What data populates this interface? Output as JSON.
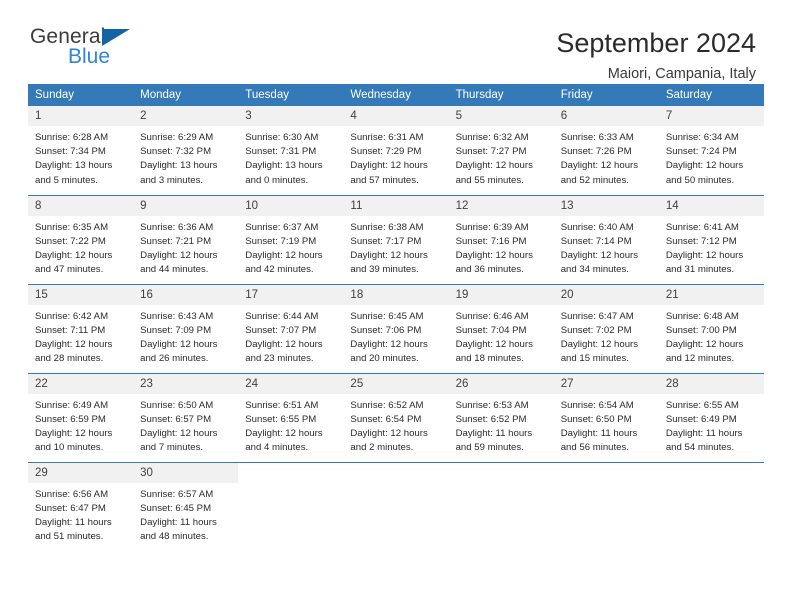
{
  "brand": {
    "name_part1": "General",
    "name_part2": "Blue",
    "triangle_color": "#1464a5",
    "blue_color": "#2f86d4"
  },
  "header": {
    "title": "September 2024",
    "subtitle": "Maiori, Campania, Italy"
  },
  "theme": {
    "header_blue": "#3479b8",
    "daynum_band": "#f1f1f1",
    "text": "#2b2b2b"
  },
  "weekday_headers": [
    "Sunday",
    "Monday",
    "Tuesday",
    "Wednesday",
    "Thursday",
    "Friday",
    "Saturday"
  ],
  "weeks": [
    [
      {
        "day": "1",
        "sunrise": "Sunrise: 6:28 AM",
        "sunset": "Sunset: 7:34 PM",
        "daylight_line1": "Daylight: 13 hours",
        "daylight_line2": "and 5 minutes."
      },
      {
        "day": "2",
        "sunrise": "Sunrise: 6:29 AM",
        "sunset": "Sunset: 7:32 PM",
        "daylight_line1": "Daylight: 13 hours",
        "daylight_line2": "and 3 minutes."
      },
      {
        "day": "3",
        "sunrise": "Sunrise: 6:30 AM",
        "sunset": "Sunset: 7:31 PM",
        "daylight_line1": "Daylight: 13 hours",
        "daylight_line2": "and 0 minutes."
      },
      {
        "day": "4",
        "sunrise": "Sunrise: 6:31 AM",
        "sunset": "Sunset: 7:29 PM",
        "daylight_line1": "Daylight: 12 hours",
        "daylight_line2": "and 57 minutes."
      },
      {
        "day": "5",
        "sunrise": "Sunrise: 6:32 AM",
        "sunset": "Sunset: 7:27 PM",
        "daylight_line1": "Daylight: 12 hours",
        "daylight_line2": "and 55 minutes."
      },
      {
        "day": "6",
        "sunrise": "Sunrise: 6:33 AM",
        "sunset": "Sunset: 7:26 PM",
        "daylight_line1": "Daylight: 12 hours",
        "daylight_line2": "and 52 minutes."
      },
      {
        "day": "7",
        "sunrise": "Sunrise: 6:34 AM",
        "sunset": "Sunset: 7:24 PM",
        "daylight_line1": "Daylight: 12 hours",
        "daylight_line2": "and 50 minutes."
      }
    ],
    [
      {
        "day": "8",
        "sunrise": "Sunrise: 6:35 AM",
        "sunset": "Sunset: 7:22 PM",
        "daylight_line1": "Daylight: 12 hours",
        "daylight_line2": "and 47 minutes."
      },
      {
        "day": "9",
        "sunrise": "Sunrise: 6:36 AM",
        "sunset": "Sunset: 7:21 PM",
        "daylight_line1": "Daylight: 12 hours",
        "daylight_line2": "and 44 minutes."
      },
      {
        "day": "10",
        "sunrise": "Sunrise: 6:37 AM",
        "sunset": "Sunset: 7:19 PM",
        "daylight_line1": "Daylight: 12 hours",
        "daylight_line2": "and 42 minutes."
      },
      {
        "day": "11",
        "sunrise": "Sunrise: 6:38 AM",
        "sunset": "Sunset: 7:17 PM",
        "daylight_line1": "Daylight: 12 hours",
        "daylight_line2": "and 39 minutes."
      },
      {
        "day": "12",
        "sunrise": "Sunrise: 6:39 AM",
        "sunset": "Sunset: 7:16 PM",
        "daylight_line1": "Daylight: 12 hours",
        "daylight_line2": "and 36 minutes."
      },
      {
        "day": "13",
        "sunrise": "Sunrise: 6:40 AM",
        "sunset": "Sunset: 7:14 PM",
        "daylight_line1": "Daylight: 12 hours",
        "daylight_line2": "and 34 minutes."
      },
      {
        "day": "14",
        "sunrise": "Sunrise: 6:41 AM",
        "sunset": "Sunset: 7:12 PM",
        "daylight_line1": "Daylight: 12 hours",
        "daylight_line2": "and 31 minutes."
      }
    ],
    [
      {
        "day": "15",
        "sunrise": "Sunrise: 6:42 AM",
        "sunset": "Sunset: 7:11 PM",
        "daylight_line1": "Daylight: 12 hours",
        "daylight_line2": "and 28 minutes."
      },
      {
        "day": "16",
        "sunrise": "Sunrise: 6:43 AM",
        "sunset": "Sunset: 7:09 PM",
        "daylight_line1": "Daylight: 12 hours",
        "daylight_line2": "and 26 minutes."
      },
      {
        "day": "17",
        "sunrise": "Sunrise: 6:44 AM",
        "sunset": "Sunset: 7:07 PM",
        "daylight_line1": "Daylight: 12 hours",
        "daylight_line2": "and 23 minutes."
      },
      {
        "day": "18",
        "sunrise": "Sunrise: 6:45 AM",
        "sunset": "Sunset: 7:06 PM",
        "daylight_line1": "Daylight: 12 hours",
        "daylight_line2": "and 20 minutes."
      },
      {
        "day": "19",
        "sunrise": "Sunrise: 6:46 AM",
        "sunset": "Sunset: 7:04 PM",
        "daylight_line1": "Daylight: 12 hours",
        "daylight_line2": "and 18 minutes."
      },
      {
        "day": "20",
        "sunrise": "Sunrise: 6:47 AM",
        "sunset": "Sunset: 7:02 PM",
        "daylight_line1": "Daylight: 12 hours",
        "daylight_line2": "and 15 minutes."
      },
      {
        "day": "21",
        "sunrise": "Sunrise: 6:48 AM",
        "sunset": "Sunset: 7:00 PM",
        "daylight_line1": "Daylight: 12 hours",
        "daylight_line2": "and 12 minutes."
      }
    ],
    [
      {
        "day": "22",
        "sunrise": "Sunrise: 6:49 AM",
        "sunset": "Sunset: 6:59 PM",
        "daylight_line1": "Daylight: 12 hours",
        "daylight_line2": "and 10 minutes."
      },
      {
        "day": "23",
        "sunrise": "Sunrise: 6:50 AM",
        "sunset": "Sunset: 6:57 PM",
        "daylight_line1": "Daylight: 12 hours",
        "daylight_line2": "and 7 minutes."
      },
      {
        "day": "24",
        "sunrise": "Sunrise: 6:51 AM",
        "sunset": "Sunset: 6:55 PM",
        "daylight_line1": "Daylight: 12 hours",
        "daylight_line2": "and 4 minutes."
      },
      {
        "day": "25",
        "sunrise": "Sunrise: 6:52 AM",
        "sunset": "Sunset: 6:54 PM",
        "daylight_line1": "Daylight: 12 hours",
        "daylight_line2": "and 2 minutes."
      },
      {
        "day": "26",
        "sunrise": "Sunrise: 6:53 AM",
        "sunset": "Sunset: 6:52 PM",
        "daylight_line1": "Daylight: 11 hours",
        "daylight_line2": "and 59 minutes."
      },
      {
        "day": "27",
        "sunrise": "Sunrise: 6:54 AM",
        "sunset": "Sunset: 6:50 PM",
        "daylight_line1": "Daylight: 11 hours",
        "daylight_line2": "and 56 minutes."
      },
      {
        "day": "28",
        "sunrise": "Sunrise: 6:55 AM",
        "sunset": "Sunset: 6:49 PM",
        "daylight_line1": "Daylight: 11 hours",
        "daylight_line2": "and 54 minutes."
      }
    ],
    [
      {
        "day": "29",
        "sunrise": "Sunrise: 6:56 AM",
        "sunset": "Sunset: 6:47 PM",
        "daylight_line1": "Daylight: 11 hours",
        "daylight_line2": "and 51 minutes."
      },
      {
        "day": "30",
        "sunrise": "Sunrise: 6:57 AM",
        "sunset": "Sunset: 6:45 PM",
        "daylight_line1": "Daylight: 11 hours",
        "daylight_line2": "and 48 minutes."
      },
      {
        "day": "",
        "sunrise": "",
        "sunset": "",
        "daylight_line1": "",
        "daylight_line2": ""
      },
      {
        "day": "",
        "sunrise": "",
        "sunset": "",
        "daylight_line1": "",
        "daylight_line2": ""
      },
      {
        "day": "",
        "sunrise": "",
        "sunset": "",
        "daylight_line1": "",
        "daylight_line2": ""
      },
      {
        "day": "",
        "sunrise": "",
        "sunset": "",
        "daylight_line1": "",
        "daylight_line2": ""
      },
      {
        "day": "",
        "sunrise": "",
        "sunset": "",
        "daylight_line1": "",
        "daylight_line2": ""
      }
    ]
  ]
}
